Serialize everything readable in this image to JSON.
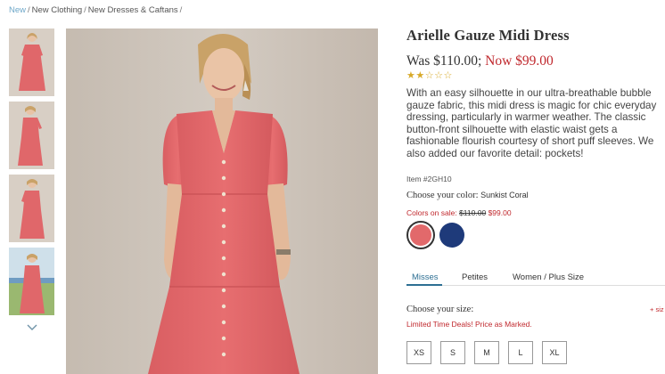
{
  "breadcrumb": {
    "items": [
      "New",
      "New Clothing",
      "New Dresses & Caftans"
    ],
    "separator": "/"
  },
  "gallery": {
    "thumbnail_count": 4,
    "arrow_icon": "chevron-down-icon"
  },
  "product": {
    "title": "Arielle Gauze Midi Dress",
    "price_was": "Was $110.00;",
    "price_now": "Now $99.00",
    "rating": {
      "filled": 2,
      "total": 5
    },
    "description": "With an easy silhouette in our ultra-breathable bubble gauze fabric, this midi dress is magic for chic everyday dressing, particularly in warmer weather. The classic button-front silhouette with elastic waist gets a fashionable flourish courtesy of short puff sleeves. We also added our favorite detail: pockets!",
    "item_number": "Item #2GH10"
  },
  "color": {
    "label": "Choose your color:",
    "selected": "Sunkist Coral",
    "sale_label": "Colors on sale:",
    "sale_old": "$110.00",
    "sale_new": "$99.00",
    "swatches": [
      {
        "name": "Sunkist Coral",
        "hex": "#e2696b"
      },
      {
        "name": "Navy",
        "hex": "#1e3a7a"
      }
    ]
  },
  "size": {
    "tabs": [
      "Misses",
      "Petites",
      "Women / Plus Size"
    ],
    "active_tab": "Misses",
    "label": "Choose your size:",
    "chart_link": "+ siz",
    "deal_text": "Limited Time Deals! Price as Marked.",
    "options": [
      "XS",
      "S",
      "M",
      "L",
      "XL"
    ]
  },
  "colors": {
    "accent_red": "#c0282d",
    "link_blue": "#2d6f93",
    "star_gold": "#d7a928"
  }
}
